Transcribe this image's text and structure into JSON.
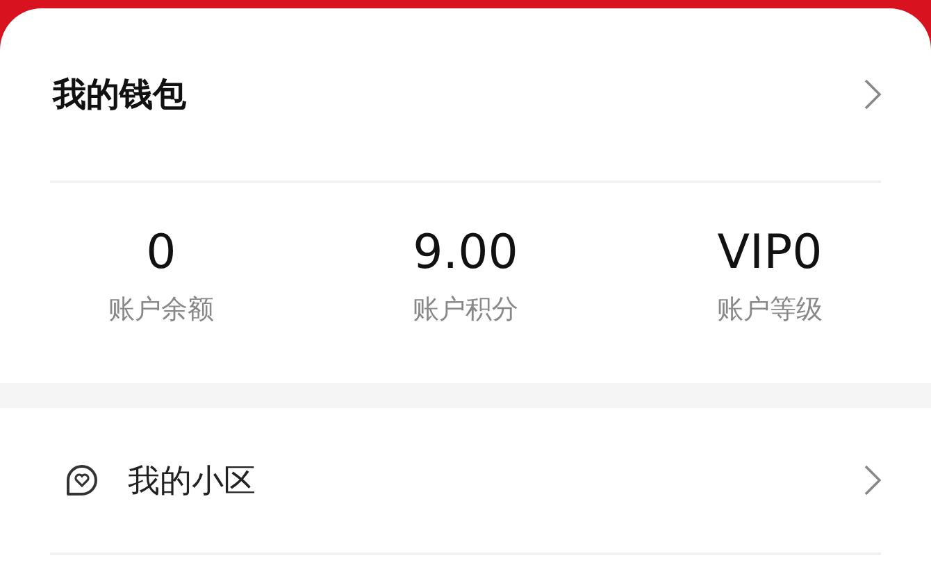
{
  "wallet": {
    "title": "我的钱包",
    "stats": [
      {
        "value": "0",
        "label": "账户余额"
      },
      {
        "value": "9.00",
        "label": "账户积分"
      },
      {
        "value": "VIP0",
        "label": "账户等级"
      }
    ]
  },
  "menu": [
    {
      "label": "我的小区"
    }
  ]
}
